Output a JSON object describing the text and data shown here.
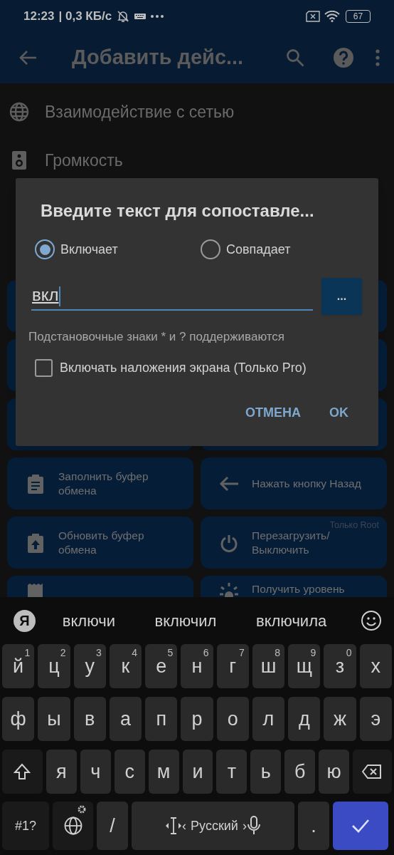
{
  "status_bar": {
    "time": "12:23",
    "speed": "| 0,3 КБ/с",
    "battery": "67"
  },
  "app_bar": {
    "title": "Добавить дейс..."
  },
  "list": [
    {
      "label": "Взаимодействие с сетью"
    },
    {
      "label": "Громкость"
    }
  ],
  "tiles": [
    {
      "label": "Заполнить буфер обмена"
    },
    {
      "label": "Нажать кнопку Назад"
    },
    {
      "label": "Обновить буфер обмена"
    },
    {
      "label": "Перезагрузить/ Выключить",
      "note": "Только Root"
    },
    {
      "kind": "partial"
    },
    {
      "kind": "partial",
      "label": "Получить уровень"
    }
  ],
  "dialog": {
    "title": "Введите текст для сопоставле...",
    "radios": [
      {
        "label": "Включает",
        "selected": true
      },
      {
        "label": "Совпадает",
        "selected": false
      }
    ],
    "input": {
      "value": "вкл"
    },
    "more_button": "...",
    "hint": "Подстановочные знаки * и ? поддерживаются",
    "checkbox": {
      "label": "Включать наложения экрана (Только Pro)",
      "checked": false
    },
    "buttons": [
      "ОТМЕНА",
      "OK"
    ]
  },
  "keyboard": {
    "logo": "Я",
    "suggestions": [
      "включи",
      "включил",
      "включила"
    ],
    "rows": [
      {
        "keys": [
          {
            "kind": "char",
            "label": "й",
            "hint": "1"
          },
          {
            "kind": "char",
            "label": "ц",
            "hint": "2"
          },
          {
            "kind": "char",
            "label": "у",
            "hint": "3"
          },
          {
            "kind": "char",
            "label": "к",
            "hint": "4"
          },
          {
            "kind": "char",
            "label": "е",
            "hint": "5"
          },
          {
            "kind": "char",
            "label": "н",
            "hint": "6"
          },
          {
            "kind": "char",
            "label": "г",
            "hint": "7"
          },
          {
            "kind": "char",
            "label": "ш",
            "hint": "8"
          },
          {
            "kind": "char",
            "label": "щ",
            "hint": "9"
          },
          {
            "kind": "char",
            "label": "з",
            "hint": "0"
          },
          {
            "kind": "char",
            "label": "х"
          }
        ]
      },
      {
        "keys": [
          {
            "kind": "char",
            "label": "ф"
          },
          {
            "kind": "char",
            "label": "ы"
          },
          {
            "kind": "char",
            "label": "в"
          },
          {
            "kind": "char",
            "label": "а"
          },
          {
            "kind": "char",
            "label": "п"
          },
          {
            "kind": "char",
            "label": "р"
          },
          {
            "kind": "char",
            "label": "о"
          },
          {
            "kind": "char",
            "label": "л"
          },
          {
            "kind": "char",
            "label": "д"
          },
          {
            "kind": "char",
            "label": "ж"
          },
          {
            "kind": "char",
            "label": "э"
          }
        ]
      },
      {
        "keys": [
          {
            "kind": "shift"
          },
          {
            "kind": "char",
            "label": "я"
          },
          {
            "kind": "char",
            "label": "ч"
          },
          {
            "kind": "char",
            "label": "с"
          },
          {
            "kind": "char",
            "label": "м"
          },
          {
            "kind": "char",
            "label": "и"
          },
          {
            "kind": "char",
            "label": "т"
          },
          {
            "kind": "char",
            "label": "ь"
          },
          {
            "kind": "char",
            "label": "б"
          },
          {
            "kind": "char",
            "label": "ю"
          },
          {
            "kind": "backspace"
          }
        ]
      },
      {
        "keys": [
          {
            "kind": "symbols",
            "label": "#1?"
          },
          {
            "kind": "globe"
          },
          {
            "kind": "char",
            "label": "/"
          },
          {
            "kind": "space",
            "label": "Русский",
            "left": "‹",
            "right": "›"
          },
          {
            "kind": "char",
            "label": "."
          },
          {
            "kind": "enter"
          }
        ]
      }
    ]
  }
}
